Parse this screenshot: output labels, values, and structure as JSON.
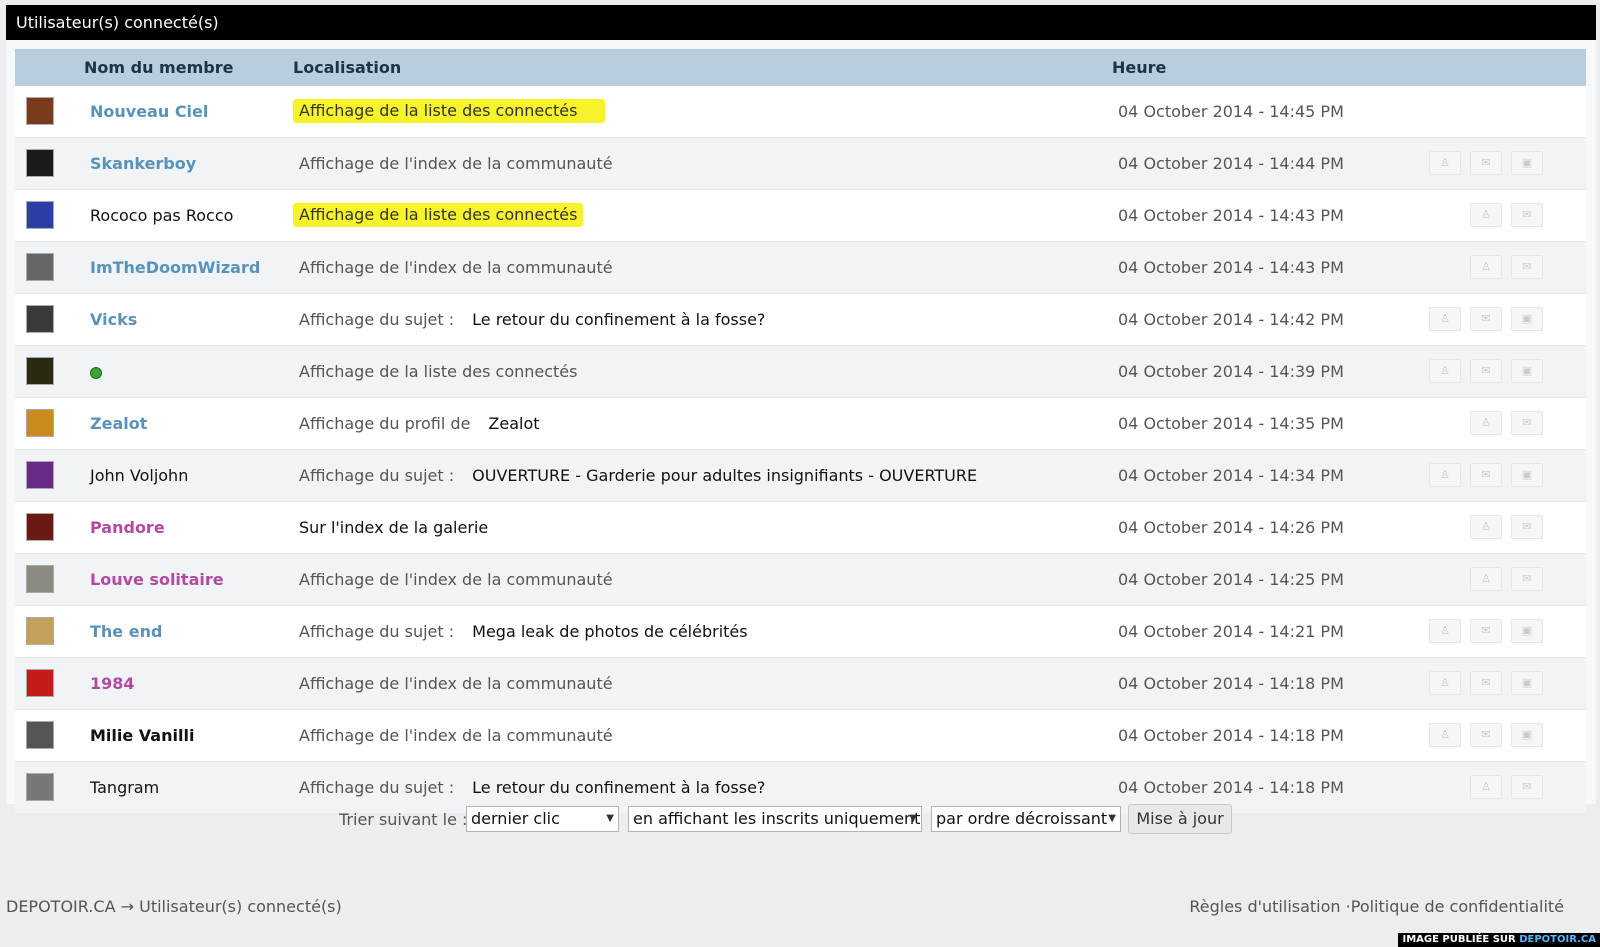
{
  "title": "Utilisateur(s) connecté(s)",
  "columns": {
    "member": "Nom du membre",
    "location": "Localisation",
    "time": "Heure"
  },
  "rows": [
    {
      "name": "Nouveau Ciel",
      "name_style": "blue",
      "location": "Affichage de la liste des connectés",
      "highlighted": true,
      "time": "04 October 2014 - 14:45 PM",
      "buttons": 0,
      "avatar_color": "#7a3a1c"
    },
    {
      "name": "Skankerboy",
      "name_style": "blue",
      "location": "Affichage de l'index de la communauté",
      "time": "04 October 2014 - 14:44 PM",
      "buttons": 3,
      "avatar_color": "#1a1a1a"
    },
    {
      "name": "Rococo pas Rocco",
      "name_style": "plain",
      "location": "Affichage de la liste des connectés",
      "highlighted": true,
      "time": "04 October 2014 - 14:43 PM",
      "buttons": 2,
      "avatar_color": "#2b3ea6"
    },
    {
      "name": "ImTheDoomWizard",
      "name_style": "blue",
      "location": "Affichage de l'index de la communauté",
      "time": "04 October 2014 - 14:43 PM",
      "buttons": 2,
      "avatar_color": "#666"
    },
    {
      "name": "Vicks",
      "name_style": "blue",
      "location": "Affichage du sujet :",
      "target": "Le retour du confinement à la fosse?",
      "time": "04 October 2014 - 14:42 PM",
      "buttons": 3,
      "avatar_color": "#3a3a3a"
    },
    {
      "name": "",
      "name_style": "dot",
      "location": "Affichage de la liste des connectés",
      "time": "04 October 2014 - 14:39 PM",
      "buttons": 3,
      "avatar_color": "#2a2a10"
    },
    {
      "name": "Zealot",
      "name_style": "blue",
      "location": "Affichage du profil de",
      "target": "Zealot",
      "time": "04 October 2014 - 14:35 PM",
      "buttons": 2,
      "avatar_color": "#c98a1f"
    },
    {
      "name": "John Voljohn",
      "name_style": "plain",
      "location": "Affichage du sujet :",
      "target": "OUVERTURE - Garderie pour adultes insignifiants - OUVERTURE",
      "time": "04 October 2014 - 14:34 PM",
      "buttons": 3,
      "avatar_color": "#6a2a8a"
    },
    {
      "name": "Pandore",
      "name_style": "purple",
      "location": "Sur l'index de la galerie",
      "location_dark": true,
      "time": "04 October 2014 - 14:26 PM",
      "buttons": 2,
      "avatar_color": "#6a1a12"
    },
    {
      "name": "Louve solitaire",
      "name_style": "purple",
      "location": "Affichage de l'index de la communauté",
      "time": "04 October 2014 - 14:25 PM",
      "buttons": 2,
      "avatar_color": "#8a8a80"
    },
    {
      "name": "The end",
      "name_style": "blue",
      "location": "Affichage du sujet :",
      "target": "Mega leak de photos de célébrités",
      "time": "04 October 2014 - 14:21 PM",
      "buttons": 3,
      "avatar_color": "#c4a05a"
    },
    {
      "name": "1984",
      "name_style": "purple",
      "location": "Affichage de l'index de la communauté",
      "time": "04 October 2014 - 14:18 PM",
      "buttons": 3,
      "avatar_color": "#c41a1a"
    },
    {
      "name": "Milie Vanilli",
      "name_style": "bold",
      "location": "Affichage de l'index de la communauté",
      "time": "04 October 2014 - 14:18 PM",
      "buttons": 3,
      "avatar_color": "#555"
    },
    {
      "name": "Tangram",
      "name_style": "plain",
      "location": "Affichage du sujet :",
      "target": "Le retour du confinement à la fosse?",
      "time": "04 October 2014 - 14:18 PM",
      "buttons": 2,
      "avatar_color": "#777"
    }
  ],
  "sort": {
    "label": "Trier suivant le :",
    "sort_by": "dernier clic",
    "filter": "en affichant les inscrits uniquement",
    "order": "par ordre décroissant",
    "submit": "Mise à jour"
  },
  "footer": {
    "breadcrumb_site": "DEPOTOIR.CA",
    "breadcrumb_arrow": "→",
    "breadcrumb_page": "Utilisateur(s) connecté(s)",
    "rules_link": "Règles d'utilisation",
    "separator": "·",
    "privacy_link": "Politique de confidentialité",
    "stamp_text": "IMAGE PUBLIÉE SUR",
    "stamp_site": "DEPOTOIR.CA"
  },
  "colors": {
    "highlight": "#f7f32a",
    "header_bg": "#b9cde0",
    "member_blue": "#5a93b8",
    "member_purple": "#b14aa0",
    "online_dot": "#3fa235"
  },
  "icons": {
    "action_1": "user-icon",
    "action_2": "mail-icon",
    "action_3": "card-icon",
    "dropdown": "chevron-down-icon"
  }
}
